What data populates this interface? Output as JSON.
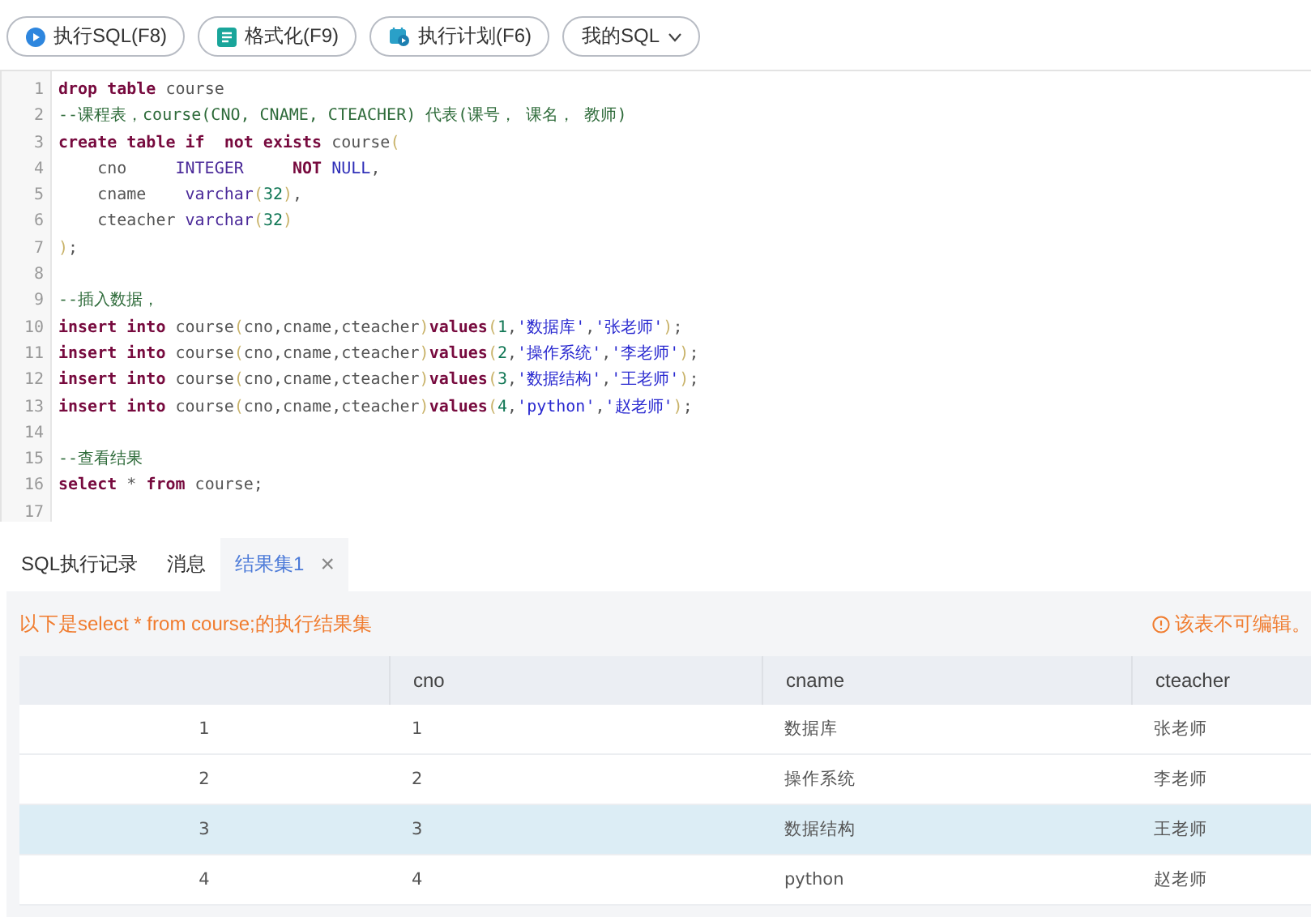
{
  "toolbar": [
    {
      "label": "执行SQL(F8)",
      "kind": "run"
    },
    {
      "label": "格式化(F9)",
      "kind": "format"
    },
    {
      "label": "执行计划(F6)",
      "kind": "plan"
    },
    {
      "label": "我的SQL",
      "kind": "dropdown"
    }
  ],
  "editor": {
    "lines": [
      {
        "number": "1",
        "tokens": [
          {
            "kind": "keyword",
            "text": "drop table"
          },
          {
            "kind": "plain",
            "text": " course"
          }
        ]
      },
      {
        "number": "2",
        "tokens": [
          {
            "kind": "comment",
            "text": "--课程表，course(CNO, CNAME, CTEACHER) 代表(课号， 课名， 教师)"
          }
        ]
      },
      {
        "number": "3",
        "tokens": [
          {
            "kind": "keyword",
            "text": "create table if  not exists"
          },
          {
            "kind": "plain",
            "text": " course"
          },
          {
            "kind": "paren",
            "text": "("
          }
        ]
      },
      {
        "number": "4",
        "tokens": [
          {
            "kind": "plain",
            "text": "    cno     "
          },
          {
            "kind": "type",
            "text": "INTEGER     "
          },
          {
            "kind": "keyword",
            "text": "NOT "
          },
          {
            "kind": "constant",
            "text": "NULL"
          },
          {
            "kind": "plain",
            "text": ","
          }
        ]
      },
      {
        "number": "5",
        "tokens": [
          {
            "kind": "plain",
            "text": "    cname    "
          },
          {
            "kind": "type",
            "text": "varchar"
          },
          {
            "kind": "paren",
            "text": "("
          },
          {
            "kind": "number",
            "text": "32"
          },
          {
            "kind": "paren",
            "text": ")"
          },
          {
            "kind": "plain",
            "text": ","
          }
        ]
      },
      {
        "number": "6",
        "tokens": [
          {
            "kind": "plain",
            "text": "    cteacher "
          },
          {
            "kind": "type",
            "text": "varchar"
          },
          {
            "kind": "paren",
            "text": "("
          },
          {
            "kind": "number",
            "text": "32"
          },
          {
            "kind": "paren",
            "text": ")"
          }
        ]
      },
      {
        "number": "7",
        "tokens": [
          {
            "kind": "paren",
            "text": ")"
          },
          {
            "kind": "plain",
            "text": ";"
          }
        ]
      },
      {
        "number": "8"
      },
      {
        "number": "9",
        "tokens": [
          {
            "kind": "comment",
            "text": "--插入数据，"
          }
        ]
      },
      {
        "number": "10",
        "tokens": [
          {
            "kind": "keyword",
            "text": "insert into"
          },
          {
            "kind": "plain",
            "text": " course"
          },
          {
            "kind": "paren",
            "text": "("
          },
          {
            "kind": "plain",
            "text": "cno,cname,cteacher"
          },
          {
            "kind": "paren",
            "text": ")"
          },
          {
            "kind": "keyword",
            "text": "values"
          },
          {
            "kind": "paren",
            "text": "("
          },
          {
            "kind": "number",
            "text": "1"
          },
          {
            "kind": "plain",
            "text": ","
          },
          {
            "kind": "string",
            "text": "'数据库'"
          },
          {
            "kind": "plain",
            "text": ","
          },
          {
            "kind": "string",
            "text": "'张老师'"
          },
          {
            "kind": "paren",
            "text": ")"
          },
          {
            "kind": "plain",
            "text": ";"
          }
        ]
      },
      {
        "number": "11",
        "tokens": [
          {
            "kind": "keyword",
            "text": "insert into"
          },
          {
            "kind": "plain",
            "text": " course"
          },
          {
            "kind": "paren",
            "text": "("
          },
          {
            "kind": "plain",
            "text": "cno,cname,cteacher"
          },
          {
            "kind": "paren",
            "text": ")"
          },
          {
            "kind": "keyword",
            "text": "values"
          },
          {
            "kind": "paren",
            "text": "("
          },
          {
            "kind": "number",
            "text": "2"
          },
          {
            "kind": "plain",
            "text": ","
          },
          {
            "kind": "string",
            "text": "'操作系统'"
          },
          {
            "kind": "plain",
            "text": ","
          },
          {
            "kind": "string",
            "text": "'李老师'"
          },
          {
            "kind": "paren",
            "text": ")"
          },
          {
            "kind": "plain",
            "text": ";"
          }
        ]
      },
      {
        "number": "12",
        "tokens": [
          {
            "kind": "keyword",
            "text": "insert into"
          },
          {
            "kind": "plain",
            "text": " course"
          },
          {
            "kind": "paren",
            "text": "("
          },
          {
            "kind": "plain",
            "text": "cno,cname,cteacher"
          },
          {
            "kind": "paren",
            "text": ")"
          },
          {
            "kind": "keyword",
            "text": "values"
          },
          {
            "kind": "paren",
            "text": "("
          },
          {
            "kind": "number",
            "text": "3"
          },
          {
            "kind": "plain",
            "text": ","
          },
          {
            "kind": "string",
            "text": "'数据结构'"
          },
          {
            "kind": "plain",
            "text": ","
          },
          {
            "kind": "string",
            "text": "'王老师'"
          },
          {
            "kind": "paren",
            "text": ")"
          },
          {
            "kind": "plain",
            "text": ";"
          }
        ]
      },
      {
        "number": "13",
        "tokens": [
          {
            "kind": "keyword",
            "text": "insert into"
          },
          {
            "kind": "plain",
            "text": " course"
          },
          {
            "kind": "paren",
            "text": "("
          },
          {
            "kind": "plain",
            "text": "cno,cname,cteacher"
          },
          {
            "kind": "paren",
            "text": ")"
          },
          {
            "kind": "keyword",
            "text": "values"
          },
          {
            "kind": "paren",
            "text": "("
          },
          {
            "kind": "number",
            "text": "4"
          },
          {
            "kind": "plain",
            "text": ","
          },
          {
            "kind": "string",
            "text": "'python'"
          },
          {
            "kind": "plain",
            "text": ","
          },
          {
            "kind": "string",
            "text": "'赵老师'"
          },
          {
            "kind": "paren",
            "text": ")"
          },
          {
            "kind": "plain",
            "text": ";"
          }
        ]
      },
      {
        "number": "14"
      },
      {
        "number": "15",
        "tokens": [
          {
            "kind": "comment",
            "text": "--查看结果"
          }
        ]
      },
      {
        "number": "16",
        "tokens": [
          {
            "kind": "keyword",
            "text": "select"
          },
          {
            "kind": "plain",
            "text": " * "
          },
          {
            "kind": "keyword",
            "text": "from"
          },
          {
            "kind": "plain",
            "text": " course;"
          }
        ]
      },
      {
        "number": "17"
      }
    ]
  },
  "result_tabs": [
    {
      "label": "SQL执行记录",
      "selected": false
    },
    {
      "label": "消息",
      "selected": false
    },
    {
      "label": "结果集1",
      "selected": true,
      "close": "×"
    }
  ],
  "result": {
    "message": "以下是select * from course;的执行结果集",
    "notice": "该表不可编辑。",
    "columns": [
      "cno",
      "cname",
      "cteacher"
    ],
    "rows": [
      {
        "index": "1",
        "cells": [
          "1",
          "数据库",
          "张老师"
        ],
        "selected": false
      },
      {
        "index": "2",
        "cells": [
          "2",
          "操作系统",
          "李老师"
        ],
        "selected": false
      },
      {
        "index": "3",
        "cells": [
          "3",
          "数据结构",
          "王老师"
        ],
        "selected": true
      },
      {
        "index": "4",
        "cells": [
          "4",
          "python",
          "赵老师"
        ],
        "selected": false
      }
    ]
  }
}
